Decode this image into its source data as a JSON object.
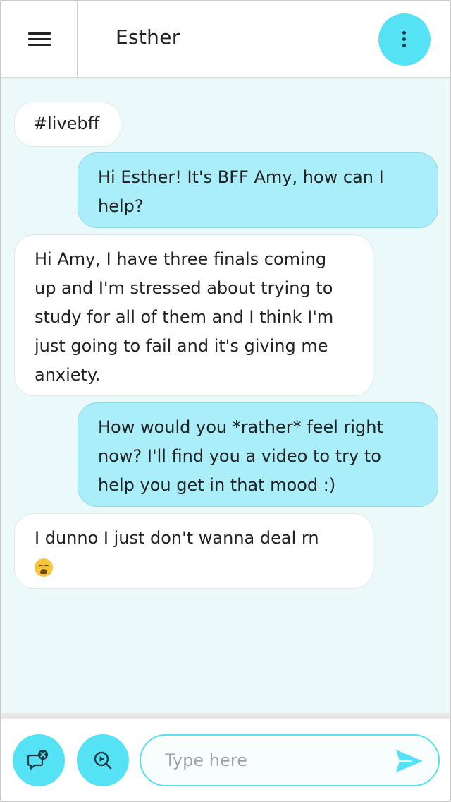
{
  "header": {
    "title": "Esther",
    "menu_icon": "hamburger-menu-icon",
    "more_icon": "vertical-dots-icon"
  },
  "messages": [
    {
      "side": "incoming",
      "text": "#livebff"
    },
    {
      "side": "outgoing",
      "text": "Hi Esther! It's BFF Amy, how can I help?"
    },
    {
      "side": "incoming",
      "text": "Hi Amy, I have three finals coming up and I'm stressed about trying to study for all of them and I think I'm just going to fail and it's giving me anxiety."
    },
    {
      "side": "outgoing",
      "text": "How would you *rather* feel right now? I'll find you a video to try to help you get in that mood :)"
    },
    {
      "side": "incoming",
      "text": "I dunno I just don't wanna deal rn",
      "emoji": "weary-face-emoji"
    }
  ],
  "composer": {
    "placeholder": "Type here",
    "value": "",
    "left_button_icon": "chat-bubble-close-icon",
    "second_button_icon": "video-search-icon",
    "send_icon": "send-icon"
  },
  "colors": {
    "accent": "#55e2f4",
    "outgoing_bubble": "#aaeef9",
    "chat_background": "#ebf9fb",
    "incoming_bubble": "#ffffff"
  }
}
